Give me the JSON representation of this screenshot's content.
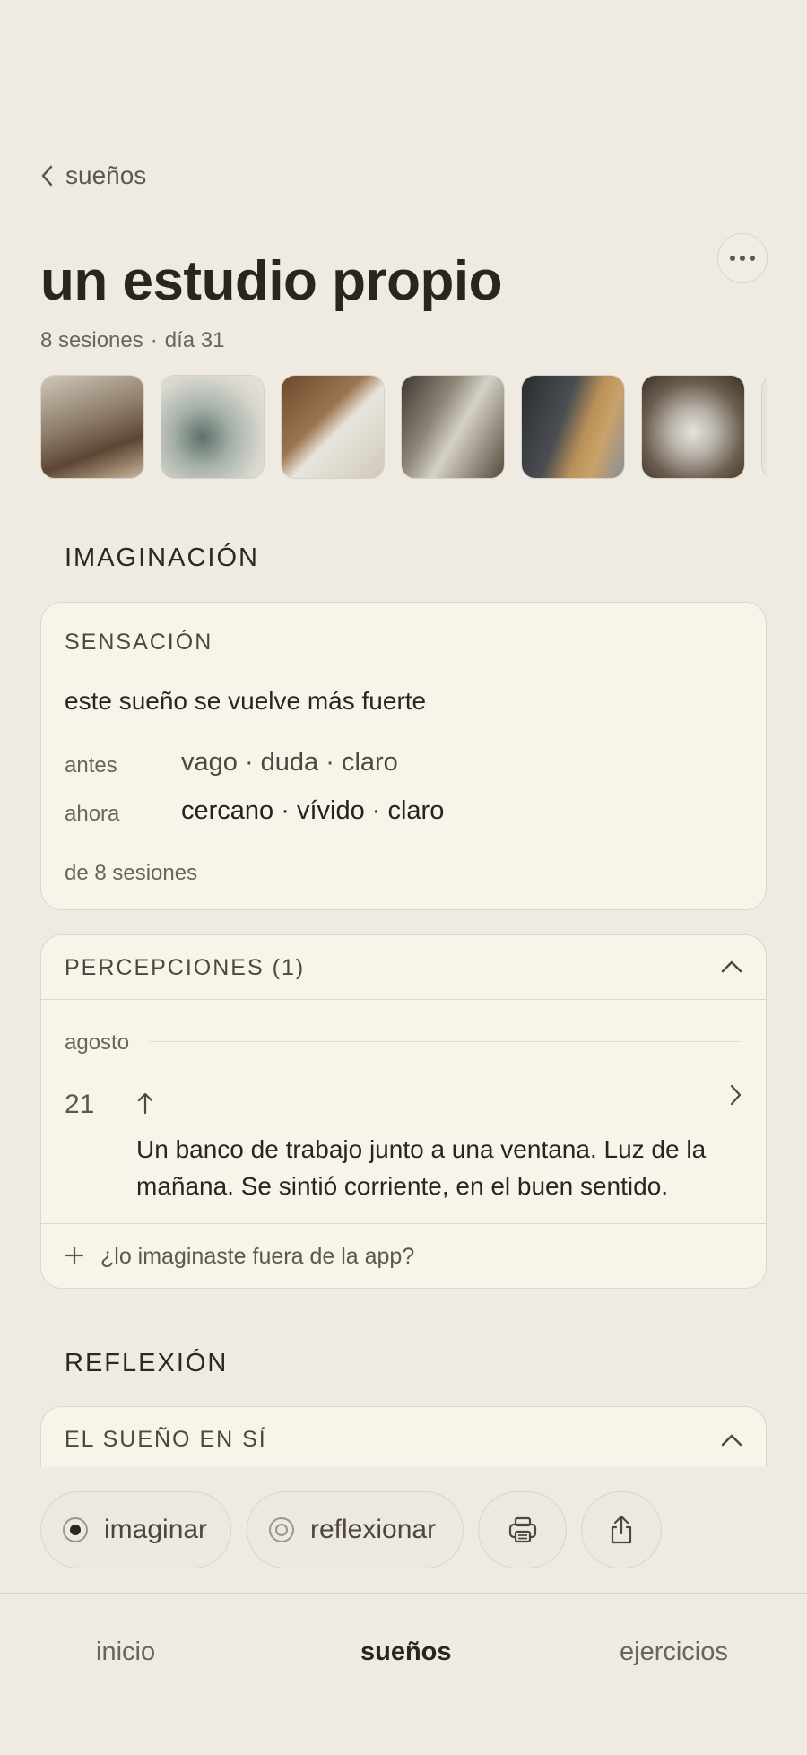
{
  "header": {
    "back_label": "sueños",
    "title": "un estudio propio",
    "sessions": "8 sesiones",
    "separator": "·",
    "day": "día 31",
    "more_icon": "ellipsis-icon"
  },
  "gallery": {
    "items": [
      "brushes",
      "paint-hands",
      "attic-window",
      "palette-knife",
      "painting-hand",
      "paint-tubes",
      "more"
    ]
  },
  "imagination": {
    "section_title": "IMAGINACIÓN",
    "sensation": {
      "label": "SENSACIÓN",
      "text": "este sueño se vuelve más fuerte",
      "before_key": "antes",
      "before_value": "vago · duda · claro",
      "now_key": "ahora",
      "now_value": "cercano · vívido · claro",
      "footer": "de 8 sesiones"
    },
    "perceptions": {
      "label": "PERCEPCIONES",
      "count": "(1)",
      "month": "agosto",
      "entry_day": "21",
      "entry_text": "Un banco de trabajo junto a una ventana. Luz de la mañana. Se sintió corriente, en el buen sentido.",
      "add_label": "¿lo imaginaste fuera de la app?"
    }
  },
  "reflection": {
    "section_title": "REFLEXIÓN",
    "dream_label": "EL SUEÑO EN SÍ"
  },
  "actions": {
    "imagine": "imaginar",
    "reflect": "reflexionar",
    "print_icon": "printer-icon",
    "share_icon": "share-icon"
  },
  "nav": {
    "home": "inicio",
    "dreams": "sueños",
    "exercises": "ejercicios"
  },
  "colors": {
    "background": "#efebe2",
    "card": "#f8f4ea",
    "text": "#2a251f",
    "muted": "#6b645a",
    "border": "#ddd7ca"
  }
}
